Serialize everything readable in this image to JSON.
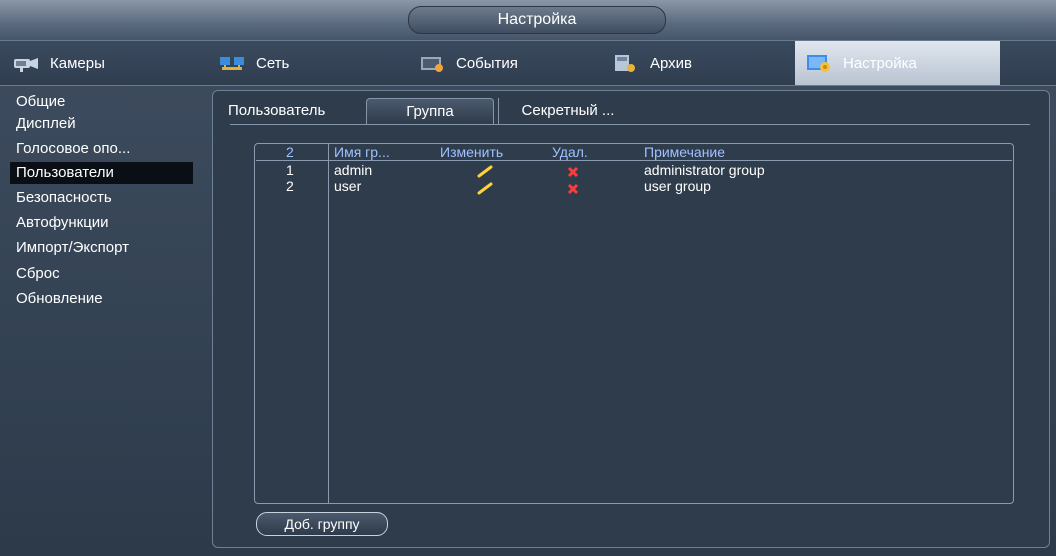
{
  "window": {
    "title": "Настройка"
  },
  "main_tabs": [
    {
      "label": "Камеры",
      "icon": "camera-icon"
    },
    {
      "label": "Сеть",
      "icon": "network-icon"
    },
    {
      "label": "События",
      "icon": "events-icon"
    },
    {
      "label": "Архив",
      "icon": "archive-icon"
    },
    {
      "label": "Настройка",
      "icon": "settings-icon",
      "active": true
    }
  ],
  "sidebar": {
    "items": [
      {
        "label": "Общие"
      },
      {
        "label": "Дисплей"
      },
      {
        "label": "Голосовое опо..."
      },
      {
        "label": "Пользователи",
        "active": true
      },
      {
        "label": "Безопасность"
      },
      {
        "label": "Автофункции"
      },
      {
        "label": "Импорт/Экспорт"
      },
      {
        "label": "Сброс"
      },
      {
        "label": "Обновление"
      }
    ]
  },
  "sub_tabs": [
    {
      "label": "Пользователь"
    },
    {
      "label": "Группа",
      "active": true
    },
    {
      "label": "Секретный ..."
    }
  ],
  "table": {
    "count": "2",
    "headers": {
      "name": "Имя гр...",
      "edit": "Изменить",
      "delete": "Удал.",
      "note": "Примечание"
    },
    "rows": [
      {
        "index": "1",
        "name": "admin",
        "note": "administrator group"
      },
      {
        "index": "2",
        "name": "user",
        "note": "user group"
      }
    ]
  },
  "add_group_button": "Доб. группу",
  "colors": {
    "accent_header_text": "#9fc1ff",
    "active_tab": "#c7d0dc",
    "delete_icon": "#ff3b3b",
    "edit_icon": "#ffd23a"
  }
}
